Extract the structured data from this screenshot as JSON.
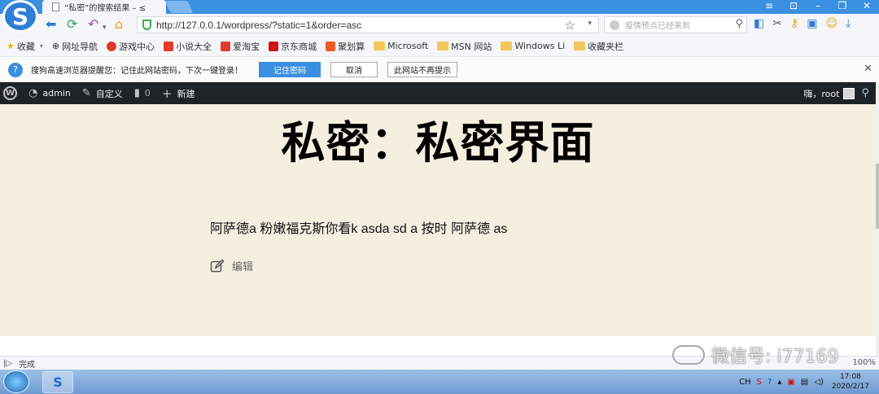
{
  "browser": {
    "tab_title": "“私密”的搜索结果 – ≤",
    "url": "http://127.0.0.1/wordpress/?static=1&order=asc",
    "search_placeholder": "疫情预点已经来到",
    "window_controls": [
      "≡",
      "⊡",
      "–",
      "❐",
      "✕"
    ],
    "bookmarks": [
      {
        "label": "收藏",
        "icon": "star-icon",
        "color": "#f2b400"
      },
      {
        "label": "网址导航",
        "icon": "globe-icon",
        "color": "#777777"
      },
      {
        "label": "游戏中心",
        "icon": "game-icon",
        "color": "#e23b2a"
      },
      {
        "label": "小说大全",
        "icon": "book-icon",
        "color": "#e23b2a"
      },
      {
        "label": "爱淘宝",
        "icon": "taobao-icon",
        "color": "#e23b2a"
      },
      {
        "label": "京东商城",
        "icon": "jd-icon",
        "color": "#d0111b"
      },
      {
        "label": "聚划算",
        "icon": "juhuasuan-icon",
        "color": "#ee5a24"
      },
      {
        "label": "Microsoft",
        "icon": "folder-icon",
        "color": "#f3c75a"
      },
      {
        "label": "MSN 网站",
        "icon": "folder-icon",
        "color": "#f3c75a"
      },
      {
        "label": "Windows Li",
        "icon": "folder-icon",
        "color": "#f3c75a"
      },
      {
        "label": "收藏夹栏",
        "icon": "folder-icon",
        "color": "#f3c75a"
      }
    ],
    "notice": {
      "message": "搜狗高速浏览器提醒您：记住此网站密码，下次一键登录！",
      "remember_btn": "记住密码",
      "cancel_btn": "取消",
      "never_btn": "此网站不再提示"
    },
    "status_text": "完成",
    "zoom": "100%"
  },
  "wp_admin_bar": {
    "site_name": "admin",
    "customize": "自定义",
    "comments_count": "0",
    "new_label": "新建",
    "greeting": "嗨，root"
  },
  "post": {
    "title": "私密：私密界面",
    "content": "阿萨德a 粉嫩福克斯你看k asda sd a 按时 阿萨德 as",
    "edit_label": "编辑"
  },
  "watermark": "微信号: i77169",
  "taskbar": {
    "lang": "CH",
    "time": "17:08",
    "date": "2020/2/17"
  },
  "colors": {
    "accent": "#3b8fe0",
    "page_bg": "#f5efe0",
    "wp_bar": "#1d2327"
  }
}
